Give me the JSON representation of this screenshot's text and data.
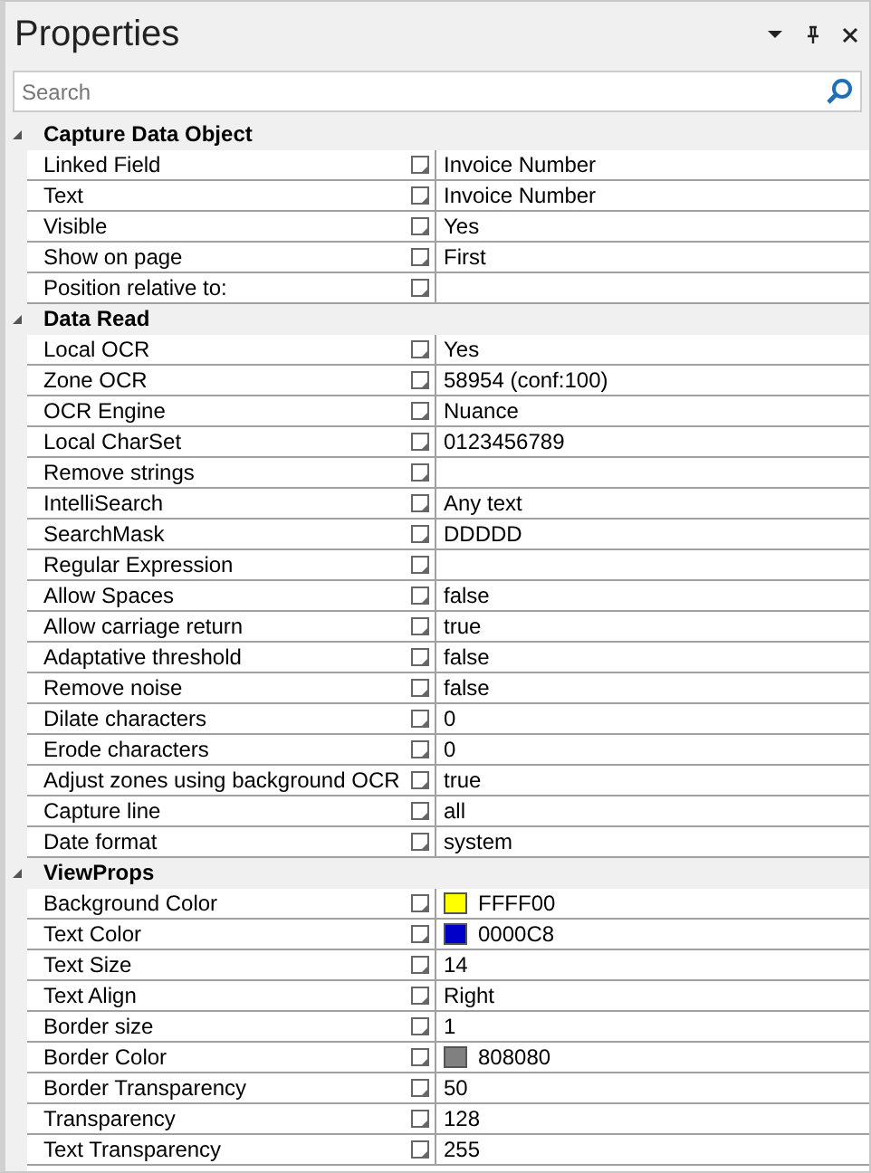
{
  "panel": {
    "title": "Properties",
    "search": {
      "placeholder": "Search"
    }
  },
  "categories": [
    {
      "name": "Capture Data Object",
      "expanded": true,
      "properties": [
        {
          "name": "Linked Field",
          "value": "Invoice Number"
        },
        {
          "name": "Text",
          "value": "Invoice Number"
        },
        {
          "name": "Visible",
          "value": "Yes"
        },
        {
          "name": "Show on page",
          "value": "First"
        },
        {
          "name": "Position relative to:"
        }
      ]
    },
    {
      "name": "Data Read",
      "expanded": true,
      "properties": [
        {
          "name": "Local OCR",
          "value": "Yes"
        },
        {
          "name": "Zone OCR",
          "value": "58954 (conf:100)"
        },
        {
          "name": "OCR Engine",
          "value": "Nuance"
        },
        {
          "name": "Local CharSet",
          "value": "0123456789"
        },
        {
          "name": "Remove strings"
        },
        {
          "name": "IntelliSearch",
          "value": "Any text"
        },
        {
          "name": "SearchMask",
          "value": "DDDDD"
        },
        {
          "name": "Regular Expression"
        },
        {
          "name": "Allow Spaces",
          "value": "false"
        },
        {
          "name": "Allow carriage return",
          "value": "true"
        },
        {
          "name": "Adaptative threshold",
          "value": "false"
        },
        {
          "name": "Remove noise",
          "value": "false"
        },
        {
          "name": "Dilate characters",
          "value": "0"
        },
        {
          "name": "Erode characters",
          "value": "0"
        },
        {
          "name": "Adjust zones using background OCR",
          "value": "true"
        },
        {
          "name": "Capture line",
          "value": "all"
        },
        {
          "name": "Date format",
          "value": "system"
        }
      ]
    },
    {
      "name": "ViewProps",
      "expanded": true,
      "properties": [
        {
          "name": "Background Color",
          "kind": "color",
          "color": "#ffff00",
          "value": "FFFF00"
        },
        {
          "name": "Text Color",
          "kind": "color",
          "color": "#0000c8",
          "value": "0000C8"
        },
        {
          "name": "Text Size",
          "value": "14"
        },
        {
          "name": "Text Align",
          "value": "Right"
        },
        {
          "name": "Border size",
          "value": "1"
        },
        {
          "name": "Border Color",
          "kind": "color",
          "color": "#808080",
          "value": "808080"
        },
        {
          "name": "Border Transparency",
          "value": "50"
        },
        {
          "name": "Transparency",
          "value": "128"
        },
        {
          "name": "Text Transparency",
          "value": "255"
        }
      ]
    }
  ]
}
